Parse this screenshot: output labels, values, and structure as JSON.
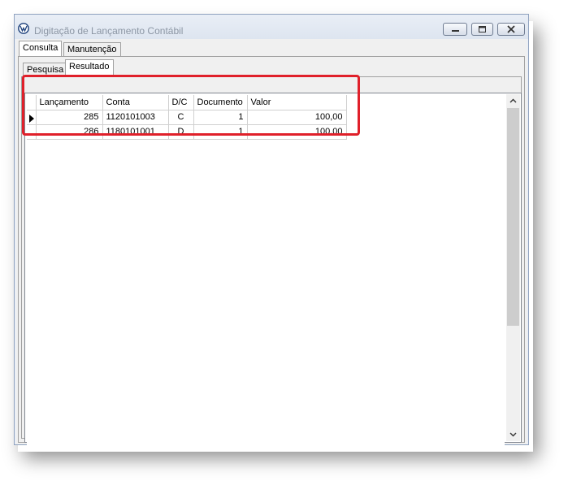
{
  "window": {
    "title": "Digitação de Lançamento Contábil",
    "icon": "vw-logo-icon",
    "controls": [
      "minimize-icon",
      "maximize-icon",
      "close-icon"
    ]
  },
  "tabs": {
    "top": [
      {
        "label": "Consulta",
        "active": true
      },
      {
        "label": "Manutenção",
        "active": false
      }
    ],
    "sub": [
      {
        "label": "Pesquisa",
        "active": false
      },
      {
        "label": "Resultado",
        "active": true
      }
    ]
  },
  "grid": {
    "columns": [
      "Lançamento",
      "Conta",
      "D/C",
      "Documento",
      "Valor"
    ],
    "rows": [
      {
        "lancamento": "285",
        "conta": "1120101003",
        "dc": "C",
        "documento": "1",
        "valor": "100,00",
        "current": true
      },
      {
        "lancamento": "286",
        "conta": "1180101001",
        "dc": "D",
        "documento": "1",
        "valor": "100,00",
        "current": false
      }
    ]
  },
  "colors": {
    "highlight": "#e0202a",
    "title_text": "#8c96a4"
  }
}
